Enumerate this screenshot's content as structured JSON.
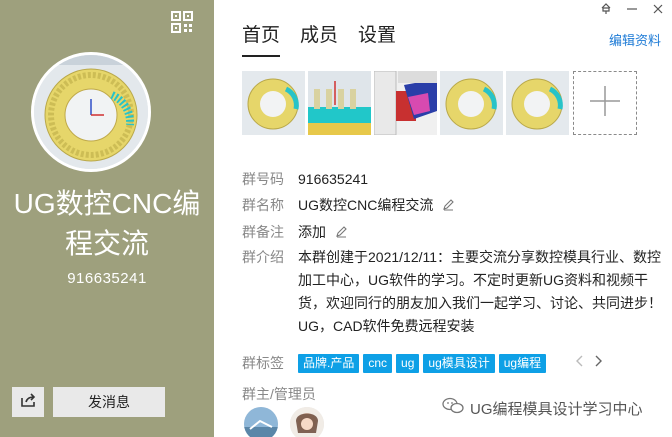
{
  "profile": {
    "name": "UG数控CNC编程交流",
    "name_line1": "UG数控CNC编",
    "name_line2": "程交流",
    "id": "916635241",
    "send_label": "发消息"
  },
  "tabs": [
    {
      "label": "首页",
      "active": true
    },
    {
      "label": "成员",
      "active": false
    },
    {
      "label": "设置",
      "active": false
    }
  ],
  "edit_label": "编辑资料",
  "info": {
    "group_id_label": "群号码",
    "group_id": "916635241",
    "group_name_label": "群名称",
    "group_name": "UG数控CNC编程交流",
    "remark_label": "群备注",
    "remark_value": "添加",
    "intro_label": "群介绍",
    "intro": "本群创建于2021/12/11：主要交流分享数控模具行业、数控加工中心，UG软件的学习。不定时更新UG资料和视频干货，欢迎同行的朋友加入我们一起学习、讨论、共同进步！UG，CAD软件免费远程安装",
    "tags_label": "群标签",
    "tags": [
      "品牌.产品",
      "cnc",
      "ug",
      "ug模具设计",
      "ug编程"
    ],
    "admins_label": "群主/管理员"
  },
  "watermark": "UG编程模具设计学习中心",
  "icons": {
    "qr": "qr-code-icon",
    "share": "share-icon",
    "pin": "pin-icon",
    "minimize": "minimize-icon",
    "close": "close-icon",
    "add": "plus-icon",
    "edit": "pencil-icon",
    "prev": "chevron-left-icon",
    "next": "chevron-right-icon"
  },
  "colors": {
    "left_panel": "#9ea07d",
    "tag": "#0ea0e6",
    "link": "#1e7bd6"
  }
}
